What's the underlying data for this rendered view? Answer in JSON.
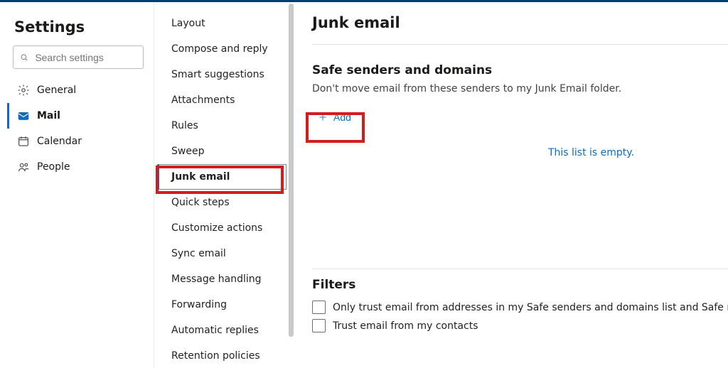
{
  "left": {
    "title": "Settings",
    "search_placeholder": "Search settings",
    "categories": [
      {
        "id": "general",
        "label": "General",
        "icon": "gear"
      },
      {
        "id": "mail",
        "label": "Mail",
        "icon": "mail",
        "selected": true
      },
      {
        "id": "calendar",
        "label": "Calendar",
        "icon": "calendar"
      },
      {
        "id": "people",
        "label": "People",
        "icon": "people"
      }
    ]
  },
  "mid": {
    "items": [
      "Layout",
      "Compose and reply",
      "Smart suggestions",
      "Attachments",
      "Rules",
      "Sweep",
      "Junk email",
      "Quick steps",
      "Customize actions",
      "Sync email",
      "Message handling",
      "Forwarding",
      "Automatic replies",
      "Retention policies"
    ],
    "selected_index": 6,
    "scrollbar": {
      "top_pct": 0,
      "height_pct": 92
    }
  },
  "right": {
    "title": "Junk email",
    "safe_senders": {
      "title": "Safe senders and domains",
      "description": "Don't move email from these senders to my Junk Email folder.",
      "add_label": "Add",
      "empty_message": "This list is empty."
    },
    "filters": {
      "title": "Filters",
      "options": [
        "Only trust email from addresses in my Safe senders and domains list and Safe mailing lists",
        "Trust email from my contacts"
      ]
    }
  },
  "annotations": {
    "highlight_junk": true,
    "highlight_add": true
  }
}
